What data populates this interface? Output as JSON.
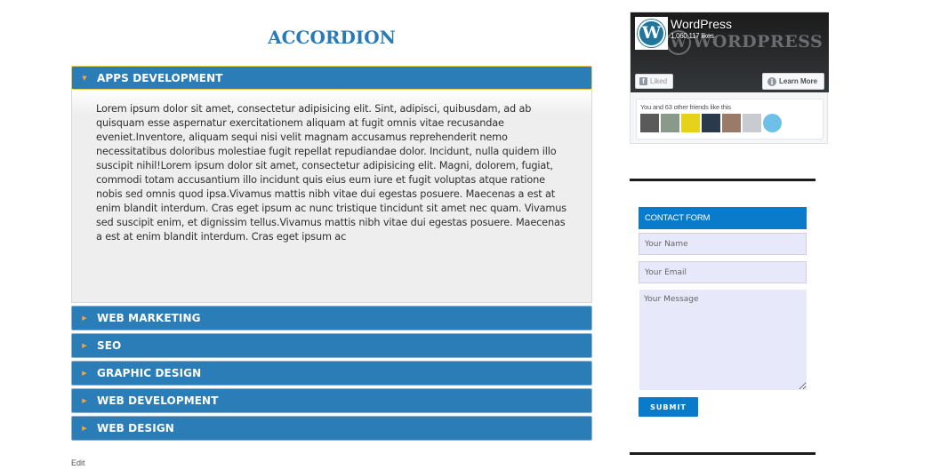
{
  "main": {
    "title": "ACCORDION",
    "accordion": [
      {
        "label": "APPS DEVELOPMENT",
        "expanded": true,
        "content": "Lorem ipsum dolor sit amet, consectetur adipisicing elit. Sint, adipisci, quibusdam, ad ab quisquam esse aspernatur exercitationem aliquam at fugit omnis vitae recusandae eveniet.Inventore, aliquam sequi nisi velit magnam accusamus reprehenderit nemo necessitatibus doloribus molestiae fugit repellat repudiandae dolor. Incidunt, nulla quidem illo suscipit nihil!Lorem ipsum dolor sit amet, consectetur adipisicing elit. Magni, dolorem, fugiat, commodi totam accusantium illo incidunt quis eius eum iure et fugit voluptas atque ratione nobis sed omnis quod ipsa.Vivamus mattis nibh vitae dui egestas posuere. Maecenas a est at enim blandit interdum. Cras eget ipsum ac nunc tristique tincidunt sit amet nec quam. Vivamus sed suscipit enim, et dignissim tellus.Vivamus mattis nibh vitae dui egestas posuere. Maecenas a est at enim blandit interdum. Cras eget ipsum ac"
      },
      {
        "label": "WEB MARKETING",
        "expanded": false
      },
      {
        "label": "SEO",
        "expanded": false
      },
      {
        "label": "GRAPHIC DESIGN",
        "expanded": false
      },
      {
        "label": "WEB DEVELOPMENT",
        "expanded": false
      },
      {
        "label": "WEB DESIGN",
        "expanded": false
      }
    ],
    "edit_link": "Edit",
    "icons": {
      "expanded": "▼",
      "collapsed": "▶"
    }
  },
  "sidebar": {
    "facebook_widget": {
      "page_name": "WordPress",
      "likes": "1,060,117 likes",
      "cover_text": "WORDPRESS",
      "logo_letter": "W",
      "liked_label": "Liked",
      "learn_more_label": "Learn More",
      "fb_glyph": "f",
      "info_glyph": "i",
      "friends_text": "You and 63 other friends like this",
      "friend_avatars": [
        "#5a5a5a",
        "#8a9a8a",
        "#e6d21a",
        "#2b3a4a",
        "#9a7a68",
        "#c8ccd0",
        "#6ec0e8"
      ]
    },
    "contact_form": {
      "title": "CONTACT FORM",
      "name_placeholder": "Your Name",
      "email_placeholder": "Your Email",
      "message_placeholder": "Your Message",
      "submit_label": "SUBMIT"
    }
  },
  "colors": {
    "accordion_header": "#2a7db6",
    "accordion_active_border": "#e8cf55",
    "arrow": "#f3a63a",
    "title": "#2a7ab8",
    "form_accent": "#0a7bca",
    "input_bg": "#e8e8fb"
  }
}
